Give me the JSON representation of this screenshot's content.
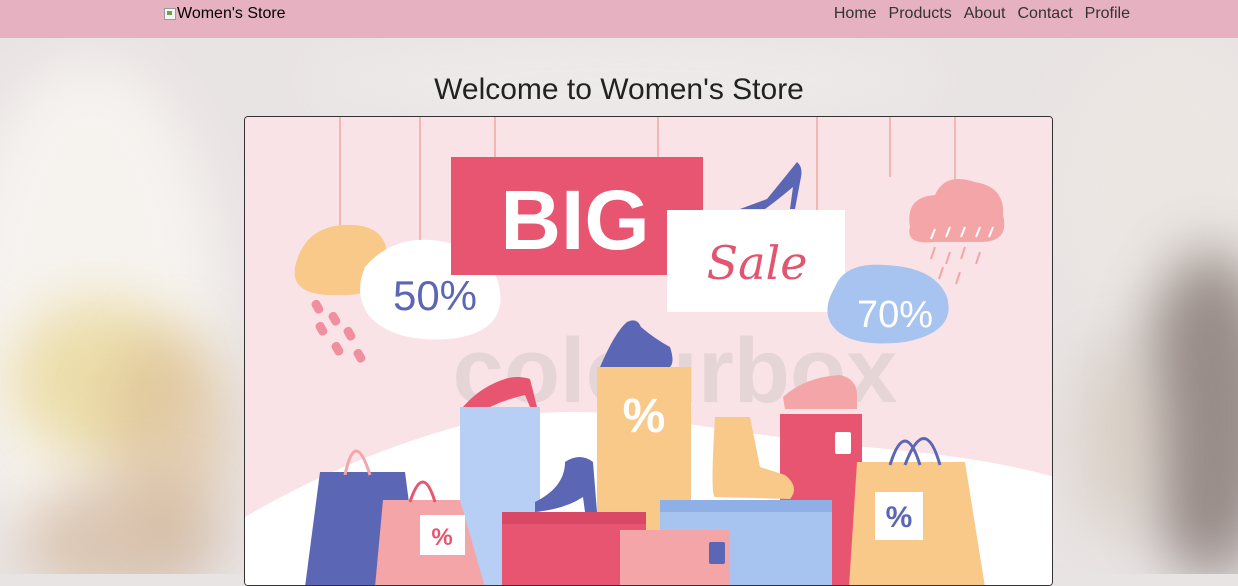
{
  "nav": {
    "brand": "Women's Store",
    "links": [
      "Home",
      "Products",
      "About",
      "Contact",
      "Profile"
    ]
  },
  "hero": {
    "title": "Welcome to Women's Store"
  },
  "banner": {
    "headline": "BIG",
    "tagline": "Sale",
    "badge_left": "50%",
    "badge_right": "70%",
    "percent_mark": "%",
    "watermark": "colourbox"
  },
  "colors": {
    "nav_bg": "#e6b2c1",
    "banner_bg": "#fae3e6",
    "accent_red": "#e85570",
    "accent_blue": "#5b66b5",
    "accent_peach": "#f9c98a"
  }
}
